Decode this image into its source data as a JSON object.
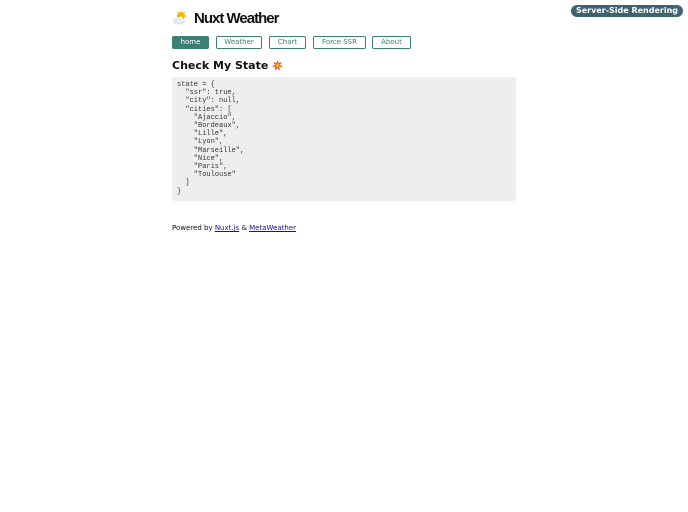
{
  "header": {
    "title": "Nuxt Weather",
    "logo_icon": "sun-behind-cloud-icon",
    "render_badge": "Server-Side Rendering"
  },
  "nav": {
    "items": [
      {
        "label": "home",
        "active": true
      },
      {
        "label": "Weather",
        "active": false
      },
      {
        "label": "Chart",
        "active": false
      },
      {
        "label": "Force SSR",
        "active": false
      },
      {
        "label": "About",
        "active": false
      }
    ]
  },
  "main": {
    "heading": "Check My State",
    "heading_icon": "collision-icon",
    "state_dump": "state = {\n  \"ssr\": true,\n  \"city\": null,\n  \"cities\": [\n    \"Ajaccio\",\n    \"Bordeaux\",\n    \"Lille\",\n    \"Lyon\",\n    \"Marseille\",\n    \"Nice\",\n    \"Paris\",\n    \"Toulouse\"\n  ]\n}"
  },
  "footer": {
    "prefix": "Powered by",
    "link1": "Nuxt.js",
    "separator": "&",
    "link2": "MetaWeather"
  },
  "colors": {
    "accent": "#3b8070",
    "badge": "#3d6472",
    "code_bg": "#eeeeee"
  }
}
